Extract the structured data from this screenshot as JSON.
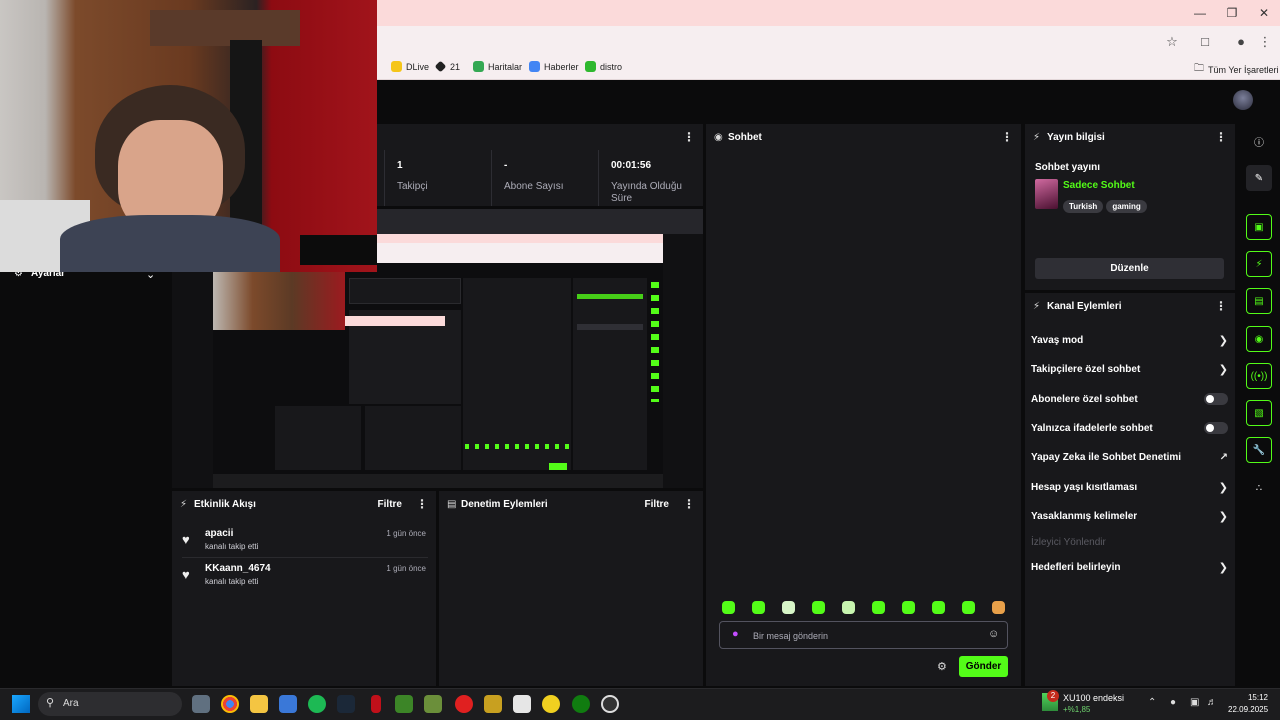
{
  "browser": {
    "bookmarks": [
      {
        "label": "DLive",
        "color": "#f5c518"
      },
      {
        "label": "21",
        "color": "#222222"
      },
      {
        "label": "Haritalar",
        "color": "#34a853"
      },
      {
        "label": "Haberler",
        "color": "#4285f4"
      },
      {
        "label": "distro",
        "color": "#2eb82e"
      }
    ],
    "all_bookmarks": "Tüm Yer İşaretleri"
  },
  "stats": [
    {
      "value": "1",
      "label": "Takipçi"
    },
    {
      "value": "-",
      "label": "Abone Sayısı"
    },
    {
      "value": "00:01:56",
      "label": "Yayında Olduğu Süre"
    }
  ],
  "sidebar": {
    "settings_label": "Ayarlar"
  },
  "activity": {
    "title": "Etkinlik Akışı",
    "filter": "Filtre",
    "events": [
      {
        "name": "apacii",
        "desc": "kanalı takip etti",
        "time": "1 gün önce"
      },
      {
        "name": "KKaann_4674",
        "desc": "kanalı takip etti",
        "time": "1 gün önce"
      }
    ]
  },
  "moderation": {
    "title": "Denetim Eylemleri",
    "filter": "Filtre"
  },
  "chat": {
    "title": "Sohbet",
    "placeholder": "Bir mesaj gönderin",
    "send": "Gönder"
  },
  "stream_info": {
    "title": "Yayın bilgisi",
    "subtitle": "Sohbet yayını",
    "category": "Sadece Sohbet",
    "tags": [
      "Turkish",
      "gaming"
    ],
    "edit": "Düzenle"
  },
  "channel_actions": {
    "title": "Kanal Eylemleri",
    "items": [
      {
        "label": "Yavaş mod",
        "control": "chevron"
      },
      {
        "label": "Takipçilere özel sohbet",
        "control": "chevron"
      },
      {
        "label": "Abonelere özel sohbet",
        "control": "toggle"
      },
      {
        "label": "Yalnızca ifadelerle sohbet",
        "control": "toggle"
      },
      {
        "label": "Yapay Zeka ile Sohbet Denetimi",
        "control": "external"
      },
      {
        "label": "Hesap yaşı kısıtlaması",
        "control": "chevron"
      },
      {
        "label": "Yasaklanmış kelimeler",
        "control": "chevron"
      },
      {
        "label": "İzleyici Yönlendir",
        "control": "disabled"
      },
      {
        "label": "Hedefleri belirleyin",
        "control": "chevron"
      }
    ]
  },
  "taskbar": {
    "search": "Ara",
    "widget_title": "XU100 endeksi",
    "widget_value": "+%1,85",
    "widget_badge": "2",
    "time": "15:12",
    "date": "22.09.2025"
  },
  "colors": {
    "accent": "#53fc18",
    "panel": "#18181b",
    "bg": "#0b0b0c"
  }
}
